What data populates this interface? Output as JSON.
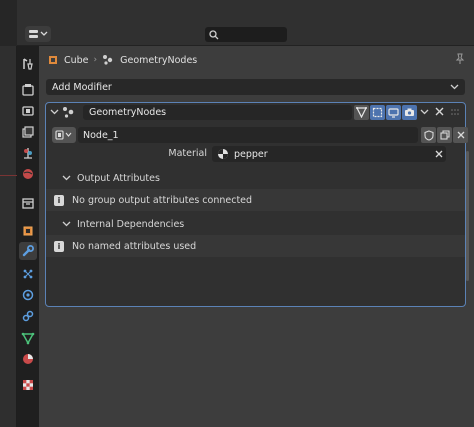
{
  "header": {
    "search_icon": "search-icon",
    "editor_type_icon": "properties-editor-icon"
  },
  "breadcrumb": {
    "object": "Cube",
    "modifier": "GeometryNodes"
  },
  "tabs": [
    {
      "name": "tool",
      "icon": "tool-icon"
    },
    {
      "name": "render",
      "icon": "render-icon"
    },
    {
      "name": "output",
      "icon": "output-icon"
    },
    {
      "name": "view-layer",
      "icon": "view-layer-icon"
    },
    {
      "name": "scene",
      "icon": "scene-icon"
    },
    {
      "name": "world",
      "icon": "world-icon"
    },
    {
      "name": "collection",
      "icon": "collection-icon"
    },
    {
      "name": "object",
      "icon": "object-icon"
    },
    {
      "name": "modifiers",
      "icon": "wrench-icon",
      "active": true
    },
    {
      "name": "particles",
      "icon": "particles-icon"
    },
    {
      "name": "physics",
      "icon": "physics-icon"
    },
    {
      "name": "constraints",
      "icon": "constraints-icon"
    },
    {
      "name": "data",
      "icon": "mesh-data-icon"
    },
    {
      "name": "material",
      "icon": "material-icon"
    },
    {
      "name": "texture",
      "icon": "texture-icon"
    }
  ],
  "add_modifier": {
    "label": "Add Modifier"
  },
  "modifier": {
    "name": "GeometryNodes",
    "node_group": "Node_1",
    "material_label": "Material",
    "material_value": "pepper",
    "output_attributes": {
      "title": "Output Attributes",
      "message": "No group output attributes connected"
    },
    "internal_dependencies": {
      "title": "Internal Dependencies",
      "message": "No named attributes used"
    }
  },
  "colors": {
    "accent": "#4d73ae",
    "panel": "#3d3d3d",
    "field": "#262626"
  }
}
